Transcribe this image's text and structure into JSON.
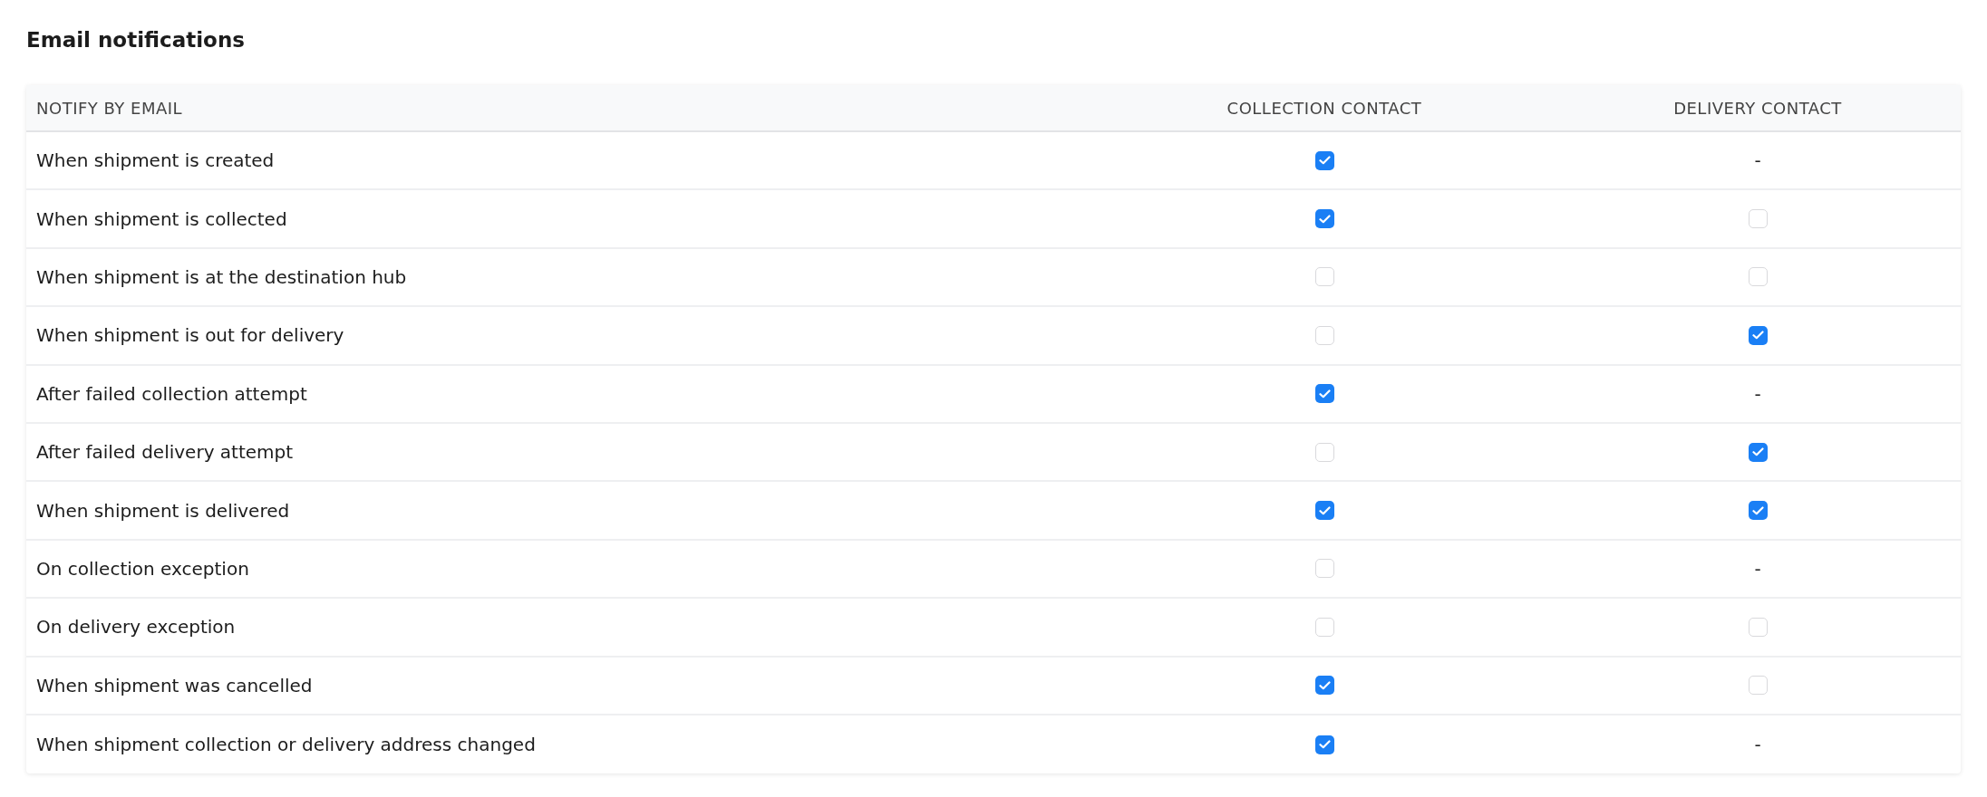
{
  "title": "Email notifications",
  "columns": [
    "NOTIFY BY EMAIL",
    "COLLECTION CONTACT",
    "DELIVERY CONTACT"
  ],
  "rows": [
    {
      "label": "When shipment is created",
      "collection": {
        "kind": "checkbox",
        "checked": true
      },
      "delivery": {
        "kind": "dash",
        "text": "-"
      }
    },
    {
      "label": "When shipment is collected",
      "collection": {
        "kind": "checkbox",
        "checked": true
      },
      "delivery": {
        "kind": "checkbox",
        "checked": false
      }
    },
    {
      "label": "When shipment is at the destination hub",
      "collection": {
        "kind": "checkbox",
        "checked": false
      },
      "delivery": {
        "kind": "checkbox",
        "checked": false
      }
    },
    {
      "label": "When shipment is out for delivery",
      "collection": {
        "kind": "checkbox",
        "checked": false
      },
      "delivery": {
        "kind": "checkbox",
        "checked": true
      }
    },
    {
      "label": "After failed collection attempt",
      "collection": {
        "kind": "checkbox",
        "checked": true
      },
      "delivery": {
        "kind": "dash",
        "text": "-"
      }
    },
    {
      "label": "After failed delivery attempt",
      "collection": {
        "kind": "checkbox",
        "checked": false
      },
      "delivery": {
        "kind": "checkbox",
        "checked": true
      }
    },
    {
      "label": "When shipment is delivered",
      "collection": {
        "kind": "checkbox",
        "checked": true
      },
      "delivery": {
        "kind": "checkbox",
        "checked": true
      }
    },
    {
      "label": "On collection exception",
      "collection": {
        "kind": "checkbox",
        "checked": false
      },
      "delivery": {
        "kind": "dash",
        "text": "-"
      }
    },
    {
      "label": "On delivery exception",
      "collection": {
        "kind": "checkbox",
        "checked": false
      },
      "delivery": {
        "kind": "checkbox",
        "checked": false
      }
    },
    {
      "label": "When shipment was cancelled",
      "collection": {
        "kind": "checkbox",
        "checked": true
      },
      "delivery": {
        "kind": "checkbox",
        "checked": false
      }
    },
    {
      "label": "When shipment collection or delivery address changed",
      "collection": {
        "kind": "checkbox",
        "checked": true
      },
      "delivery": {
        "kind": "dash",
        "text": "-"
      }
    }
  ]
}
